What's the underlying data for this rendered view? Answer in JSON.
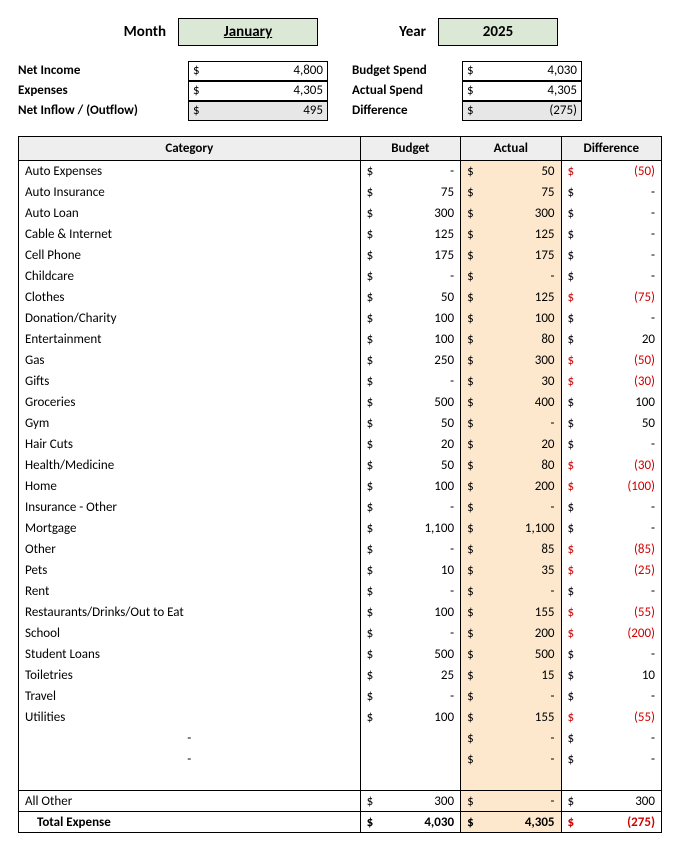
{
  "header": {
    "month_label": "Month",
    "month_value": "January",
    "year_label": "Year",
    "year_value": "2025"
  },
  "summary_left": {
    "net_income": {
      "label": "Net Income",
      "value": "4,800"
    },
    "expenses": {
      "label": "Expenses",
      "value": "4,305"
    },
    "net_inflow": {
      "label": "Net Inflow / (Outflow)",
      "value": "495"
    }
  },
  "summary_right": {
    "budget_spend": {
      "label": "Budget Spend",
      "value": "4,030"
    },
    "actual_spend": {
      "label": "Actual Spend",
      "value": "4,305"
    },
    "difference": {
      "label": "Difference",
      "value": "(275)"
    }
  },
  "table": {
    "headers": {
      "category": "Category",
      "budget": "Budget",
      "actual": "Actual",
      "difference": "Difference"
    },
    "rows": [
      {
        "category": "Auto Expenses",
        "budget": "-",
        "actual": "50",
        "diff": "(50)",
        "neg": true
      },
      {
        "category": "Auto Insurance",
        "budget": "75",
        "actual": "75",
        "diff": "-",
        "neg": false
      },
      {
        "category": "Auto Loan",
        "budget": "300",
        "actual": "300",
        "diff": "-",
        "neg": false
      },
      {
        "category": "Cable & Internet",
        "budget": "125",
        "actual": "125",
        "diff": "-",
        "neg": false
      },
      {
        "category": "Cell Phone",
        "budget": "175",
        "actual": "175",
        "diff": "-",
        "neg": false
      },
      {
        "category": "Childcare",
        "budget": "-",
        "actual": "-",
        "diff": "-",
        "neg": false
      },
      {
        "category": "Clothes",
        "budget": "50",
        "actual": "125",
        "diff": "(75)",
        "neg": true
      },
      {
        "category": "Donation/Charity",
        "budget": "100",
        "actual": "100",
        "diff": "-",
        "neg": false
      },
      {
        "category": "Entertainment",
        "budget": "100",
        "actual": "80",
        "diff": "20",
        "neg": false
      },
      {
        "category": "Gas",
        "budget": "250",
        "actual": "300",
        "diff": "(50)",
        "neg": true
      },
      {
        "category": "Gifts",
        "budget": "-",
        "actual": "30",
        "diff": "(30)",
        "neg": true
      },
      {
        "category": "Groceries",
        "budget": "500",
        "actual": "400",
        "diff": "100",
        "neg": false
      },
      {
        "category": "Gym",
        "budget": "50",
        "actual": "-",
        "diff": "50",
        "neg": false
      },
      {
        "category": "Hair Cuts",
        "budget": "20",
        "actual": "20",
        "diff": "-",
        "neg": false
      },
      {
        "category": "Health/Medicine",
        "budget": "50",
        "actual": "80",
        "diff": "(30)",
        "neg": true
      },
      {
        "category": "Home",
        "budget": "100",
        "actual": "200",
        "diff": "(100)",
        "neg": true
      },
      {
        "category": "Insurance - Other",
        "budget": "-",
        "actual": "-",
        "diff": "-",
        "neg": false
      },
      {
        "category": "Mortgage",
        "budget": "1,100",
        "actual": "1,100",
        "diff": "-",
        "neg": false
      },
      {
        "category": "Other",
        "budget": "-",
        "actual": "85",
        "diff": "(85)",
        "neg": true
      },
      {
        "category": "Pets",
        "budget": "10",
        "actual": "35",
        "diff": "(25)",
        "neg": true
      },
      {
        "category": "Rent",
        "budget": "-",
        "actual": "-",
        "diff": "-",
        "neg": false
      },
      {
        "category": "Restaurants/Drinks/Out to Eat",
        "budget": "100",
        "actual": "155",
        "diff": "(55)",
        "neg": true
      },
      {
        "category": "School",
        "budget": "-",
        "actual": "200",
        "diff": "(200)",
        "neg": true
      },
      {
        "category": "Student Loans",
        "budget": "500",
        "actual": "500",
        "diff": "-",
        "neg": false
      },
      {
        "category": "Toiletries",
        "budget": "25",
        "actual": "15",
        "diff": "10",
        "neg": false
      },
      {
        "category": "Travel",
        "budget": "-",
        "actual": "-",
        "diff": "-",
        "neg": false
      },
      {
        "category": "Utilities",
        "budget": "100",
        "actual": "155",
        "diff": "(55)",
        "neg": true
      }
    ],
    "spacers": [
      {
        "dash": "-"
      },
      {
        "dash": "-"
      }
    ],
    "all_other": {
      "label": "All Other",
      "budget": "300",
      "actual": "-",
      "diff": "300",
      "neg": false
    },
    "total": {
      "label": "Total Expense",
      "budget": "4,030",
      "actual": "4,305",
      "diff": "(275)",
      "neg": true
    }
  },
  "currency": "$"
}
